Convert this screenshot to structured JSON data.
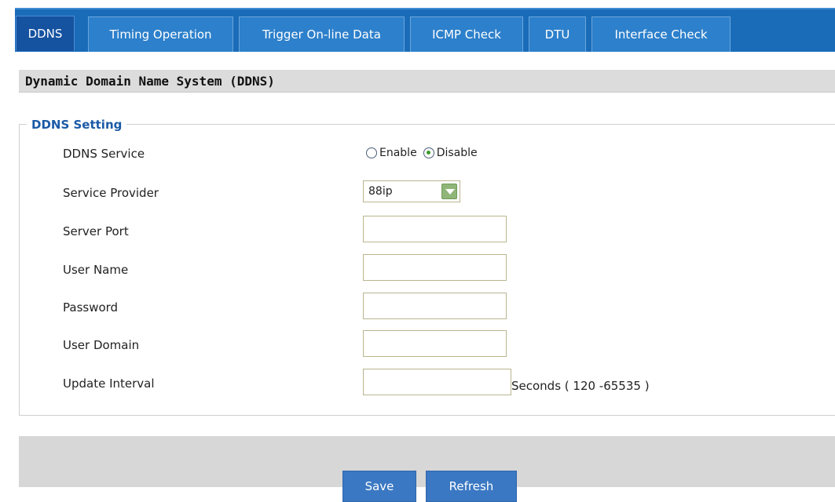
{
  "tabs": [
    {
      "label": "DDNS",
      "active": true
    },
    {
      "label": "Timing Operation"
    },
    {
      "label": "Trigger On-line Data"
    },
    {
      "label": "ICMP Check"
    },
    {
      "label": "DTU"
    },
    {
      "label": "Interface Check"
    }
  ],
  "page_title": "Dynamic Domain Name System (DDNS)",
  "section": {
    "legend": "DDNS Setting",
    "ddns_service": {
      "label": "DDNS Service",
      "options": [
        "Enable",
        "Disable"
      ],
      "selected": "Disable"
    },
    "service_provider": {
      "label": "Service Provider",
      "value": "88ip"
    },
    "server_port": {
      "label": "Server Port",
      "value": ""
    },
    "user_name": {
      "label": "User Name",
      "value": ""
    },
    "password": {
      "label": "Password",
      "value": ""
    },
    "user_domain": {
      "label": "User Domain",
      "value": ""
    },
    "update_interval": {
      "label": "Update Interval",
      "value": "",
      "suffix": "Seconds ( 120 -65535 )"
    }
  },
  "buttons": {
    "save": "Save",
    "refresh": "Refresh"
  },
  "colors": {
    "tab_bar": "#1a6cb9",
    "tab_active": "#1552a0",
    "legend": "#1b5aa6",
    "button": "#3a78c3"
  }
}
